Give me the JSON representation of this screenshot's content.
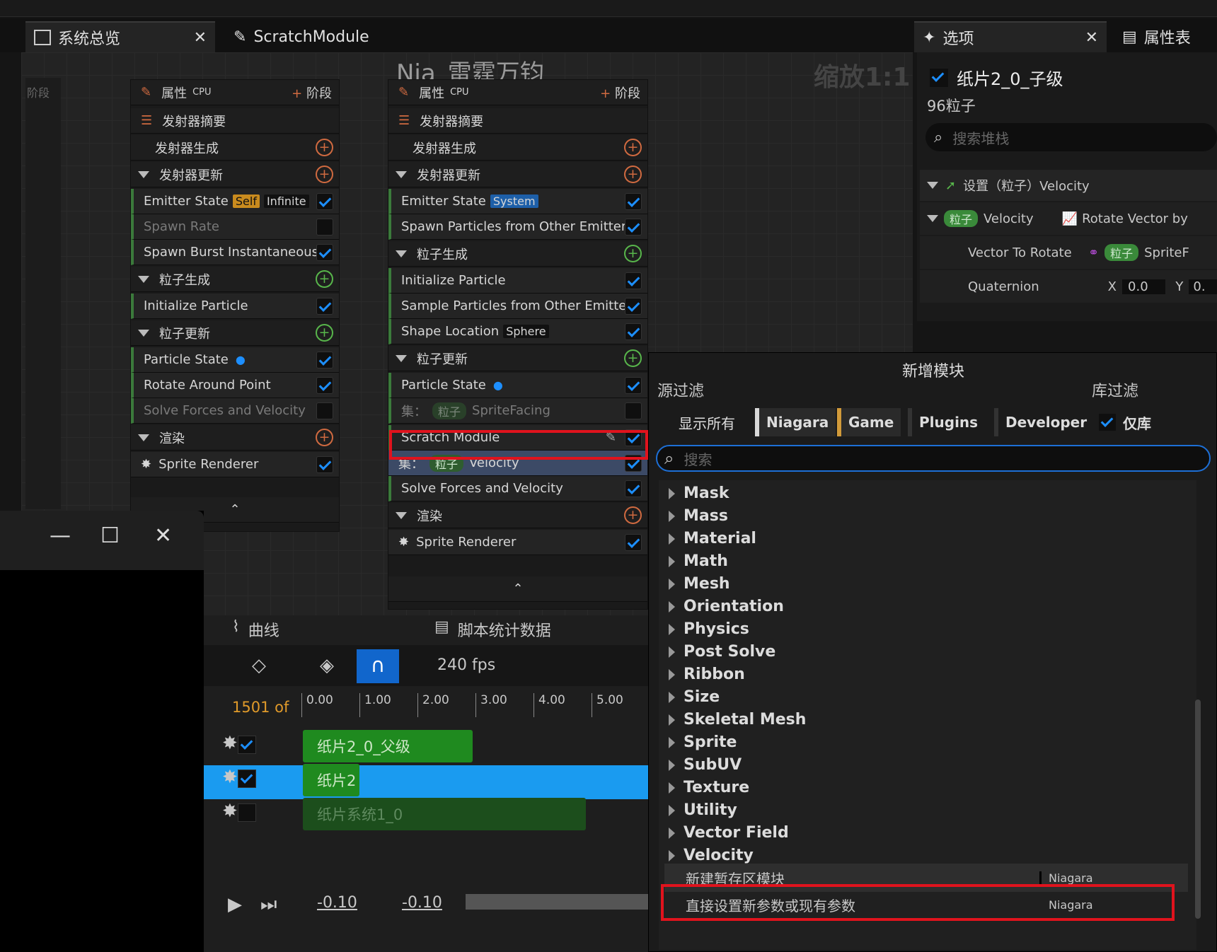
{
  "tabs": {
    "overview": "系统总览",
    "scratch": "ScratchModule",
    "options": "选项",
    "attributes": "属性表"
  },
  "graph": {
    "title": "Nia_雷霆万钧",
    "zoom": "缩放1:1",
    "strip_label": "阶段"
  },
  "left_node": {
    "header_props": "属性",
    "header_cpu": "CPU",
    "header_stage": "阶段",
    "rows": [
      "发射器摘要",
      "发射器生成",
      "发射器更新",
      "Emitter State",
      "Spawn Rate",
      "Spawn Burst Instantaneous",
      "粒子生成",
      "Initialize Particle",
      "粒子更新",
      "Particle State",
      "Rotate Around Point",
      "Solve Forces and Velocity",
      "渲染",
      "Sprite Renderer"
    ],
    "badge_self": "Self",
    "badge_infinite": "Infinite"
  },
  "mid_node": {
    "header_props": "属性",
    "header_cpu": "CPU",
    "header_stage": "阶段",
    "rows": [
      "发射器摘要",
      "发射器生成",
      "发射器更新",
      "Emitter State",
      "Spawn Particles from Other Emitter",
      "粒子生成",
      "Initialize Particle",
      "Sample Particles from Other Emitter",
      "Shape Location",
      "粒子更新",
      "Particle State",
      "SpriteFacing",
      "Scratch Module",
      "Velocity",
      "Solve Forces and Velocity",
      "渲染",
      "Sprite Renderer"
    ],
    "badge_system": "System",
    "badge_sphere": "Sphere",
    "set_prefix": "集：",
    "pill": "粒子"
  },
  "right_panel": {
    "emitter": "纸片2_0_子级",
    "count": "96粒子",
    "search": "搜索堆栈",
    "set_header": "设置（粒子）Velocity",
    "pill": "粒子",
    "velocity": "Velocity",
    "rotate": "Rotate Vector by",
    "vector_to_rotate": "Vector To Rotate",
    "sprite": "SpriteF",
    "quaternion": "Quaternion",
    "x": "X",
    "x_val": "0.0",
    "y": "Y",
    "y_val": "0."
  },
  "timeline": {
    "curves": "曲线",
    "stats": "脚本统计数据",
    "fps": "240 fps",
    "frame": "1501 of",
    "ticks": [
      "0.00",
      "1.00",
      "2.00",
      "3.00",
      "4.00",
      "5.00"
    ],
    "tracks": [
      "纸片2_0_父级",
      "纸片2",
      "纸片系统1_0"
    ],
    "t1": "-0.10",
    "t2": "-0.10"
  },
  "popup": {
    "title": "新增模块",
    "source_filter": "源过滤",
    "lib_filter": "库过滤",
    "show_all": "显示所有",
    "filters": [
      "Niagara",
      "Game",
      "Plugins",
      "Developer"
    ],
    "lib_only": "仅库",
    "search_ph": "搜索",
    "categories": [
      "Mask",
      "Mass",
      "Material",
      "Math",
      "Mesh",
      "Orientation",
      "Physics",
      "Post Solve",
      "Ribbon",
      "Size",
      "Skeletal Mesh",
      "Sprite",
      "SubUV",
      "Texture",
      "Utility",
      "Vector Field",
      "Velocity"
    ],
    "new_scratch": "新建暂存区模块",
    "new_scratch_src": "Niagara",
    "set_param": "直接设置新参数或现有参数",
    "set_param_src": "Niagara"
  },
  "colors": {
    "accent": "#1d8fff",
    "highlight": "#e0131d",
    "track_green": "#1f8a1f",
    "selected": "#1a9bf0"
  }
}
